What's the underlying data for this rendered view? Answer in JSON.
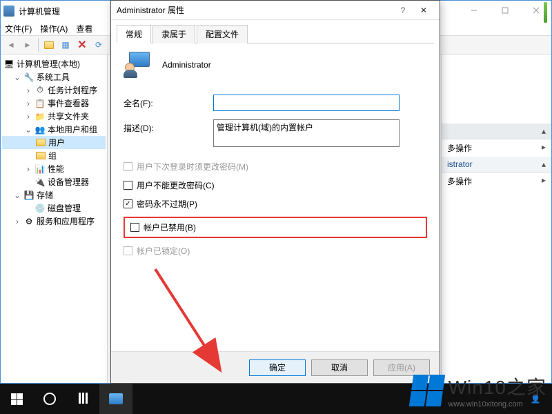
{
  "parent": {
    "title": "计算机管理",
    "menu": {
      "file": "文件(F)",
      "action": "操作(A)",
      "view": "查看"
    }
  },
  "tree": {
    "root": "计算机管理(本地)",
    "sys_tools": "系统工具",
    "task_sched": "任务计划程序",
    "event_viewer": "事件查看器",
    "shared": "共享文件夹",
    "local_users": "本地用户和组",
    "users": "用户",
    "groups": "组",
    "perf": "性能",
    "devmgr": "设备管理器",
    "storage": "存储",
    "diskmgmt": "磁盘管理",
    "services": "服务和应用程序"
  },
  "actions": {
    "more1": "多操作",
    "admin": "istrator",
    "more2": "多操作"
  },
  "dialog": {
    "title": "Administrator 属性",
    "tabs": {
      "general": "常规",
      "memberof": "隶属于",
      "profile": "配置文件"
    },
    "username": "Administrator",
    "fullname_label": "全名(F):",
    "fullname_value": "",
    "desc_label": "描述(D):",
    "desc_value": "管理计算机(域)的内置帐户",
    "checks": {
      "must_change": "用户下次登录时须更改密码(M)",
      "cannot_change": "用户不能更改密码(C)",
      "never_expire": "密码永不过期(P)",
      "disabled": "帐户已禁用(B)",
      "locked": "帐户已锁定(O)"
    },
    "buttons": {
      "ok": "确定",
      "cancel": "取消",
      "apply": "应用(A)"
    }
  },
  "watermark": {
    "brand": "Win10之家",
    "url": "www.win10xitong.com"
  }
}
